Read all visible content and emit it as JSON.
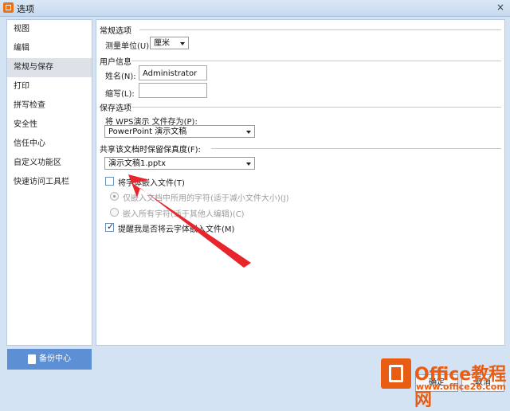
{
  "window": {
    "title": "选项",
    "close": "×"
  },
  "sidebar": {
    "items": [
      {
        "label": "视图"
      },
      {
        "label": "编辑"
      },
      {
        "label": "常规与保存",
        "active": true
      },
      {
        "label": "打印"
      },
      {
        "label": "拼写检查"
      },
      {
        "label": "安全性"
      },
      {
        "label": "信任中心"
      },
      {
        "label": "自定义功能区"
      },
      {
        "label": "快速访问工具栏"
      }
    ]
  },
  "backup": {
    "label": "备份中心"
  },
  "general": {
    "title": "常规选项",
    "unit_label": "测量单位(U):",
    "unit_value": "厘米"
  },
  "user": {
    "title": "用户信息",
    "name_label": "姓名(N):",
    "name_value": "Administrator",
    "initials_label": "缩写(L):",
    "initials_value": ""
  },
  "save": {
    "title": "保存选项",
    "save_as_label": "将 WPS演示 文件存为(P):",
    "save_as_value": "PowerPoint 演示文稿"
  },
  "fidelity": {
    "title": "共享该文档时保留保真度(F):",
    "doc_value": "演示文稿1.pptx",
    "embed_fonts_label": "将字体嵌入文件(T)",
    "embed_fonts_checked": false,
    "embed_used_label": "仅嵌入文档中所用的字符(适于减小文件大小)(J)",
    "embed_used_selected": true,
    "embed_all_label": "嵌入所有字符(适于其他人编辑)(C)",
    "embed_all_selected": false,
    "remind_label": "提醒我是否将云字体嵌入文件(M)",
    "remind_checked": true
  },
  "buttons": {
    "ok": "确定",
    "cancel": "取消"
  },
  "watermark": {
    "title": "Office教程网",
    "url": "www.office26.com"
  },
  "colors": {
    "accent": "#5c8fd4",
    "arrow": "#e8242c",
    "brand": "#e95d12"
  }
}
